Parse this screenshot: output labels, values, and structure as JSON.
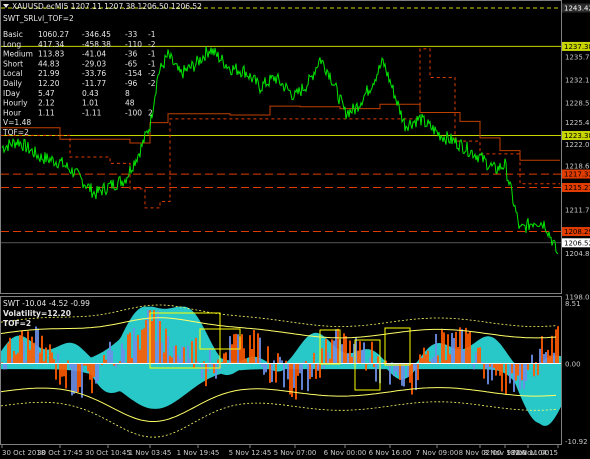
{
  "main_window": {
    "header": "XAUUSD.ecMI5  1207.11 1207.38 1206.50 1206.52",
    "indicator_name": "SWT_SRLvl_TOF=2",
    "table": [
      {
        "label": "Basic",
        "v1": "1060.27",
        "v2": "-346.45",
        "v3": "-33",
        "v4": "-1"
      },
      {
        "label": "Long",
        "v1": "417.34",
        "v2": "-458.38",
        "v3": "-110",
        "v4": "-2"
      },
      {
        "label": "Medium",
        "v1": "113.83",
        "v2": "-41.04",
        "v3": "-36",
        "v4": "-1"
      },
      {
        "label": "Short",
        "v1": "44.83",
        "v2": "-29.03",
        "v3": "-65",
        "v4": "-1"
      },
      {
        "label": "Local",
        "v1": "21.99",
        "v2": "-33.76",
        "v3": "-154",
        "v4": "-2"
      },
      {
        "label": "Daily",
        "v1": "12.20",
        "v2": "-11.77",
        "v3": "-96",
        "v4": "-2"
      },
      {
        "label": "IDay",
        "v1": "5.47",
        "v2": "0.43",
        "v3": "8",
        "v4": ""
      },
      {
        "label": "Hourly",
        "v1": "2.12",
        "v2": "1.01",
        "v3": "48",
        "v4": ""
      },
      {
        "label": "Hour",
        "v1": "1.11",
        "v2": "-1.11",
        "v3": "-100",
        "v4": "2"
      }
    ],
    "extra_lines": [
      "V=1.48",
      "TOF=2"
    ],
    "price_scale": [
      "1243.42",
      "1237.38",
      "1235.70",
      "1232.10",
      "1228.50",
      "1225.40",
      "1223.38",
      "1222.00",
      "1218.60",
      "1217.32",
      "1215.21",
      "1211.70",
      "1208.29",
      "1206.52",
      "1204.80",
      "1198.00"
    ],
    "highlight_labels": [
      {
        "value": "1243.42",
        "color": "#2a2a2a",
        "text_color": "#ffffff"
      },
      {
        "value": "1237.38",
        "color": "#c8d400",
        "text_color": "#000000"
      },
      {
        "value": "1223.38",
        "color": "#c8d400",
        "text_color": "#000000"
      },
      {
        "value": "1217.32",
        "color": "#e03c00",
        "text_color": "#000000"
      },
      {
        "value": "1215.21",
        "color": "#e03c00",
        "text_color": "#000000"
      },
      {
        "value": "1208.29",
        "color": "#e03c00",
        "text_color": "#000000"
      },
      {
        "value": "1206.52",
        "color": "#ffffff",
        "text_color": "#000000"
      }
    ]
  },
  "sub_window": {
    "header": "SWT -10.04 -4.52 -0.99",
    "volatility": "Volatility=12.20",
    "tof": "TOF=2",
    "scale": [
      "8.51",
      "0.00",
      "-10.92"
    ]
  },
  "time_axis": [
    "30 Oct 2018",
    "30 Oct 17:45",
    "30 Oct 10:45",
    "1 Nov 03:45",
    "1 Nov 19:45",
    "5 Nov 12:45",
    "5 Nov 07:00",
    "6 Nov 00:00",
    "6 Nov 16:00",
    "7 Nov 09:00",
    "8 Nov 02:00",
    "8 Nov 18:00",
    "9 Nov 11:00",
    "12 Nov 04:15"
  ],
  "colors": {
    "price_line": "#00e600",
    "ask_line": "#c8d400",
    "resistance": "#e03c00",
    "hist_orange": "#ff5a00",
    "hist_cyan": "#2bd3d3",
    "hist_blue": "#6d8fe8",
    "band_yellow": "#ffff66",
    "grid": "#606060"
  }
}
